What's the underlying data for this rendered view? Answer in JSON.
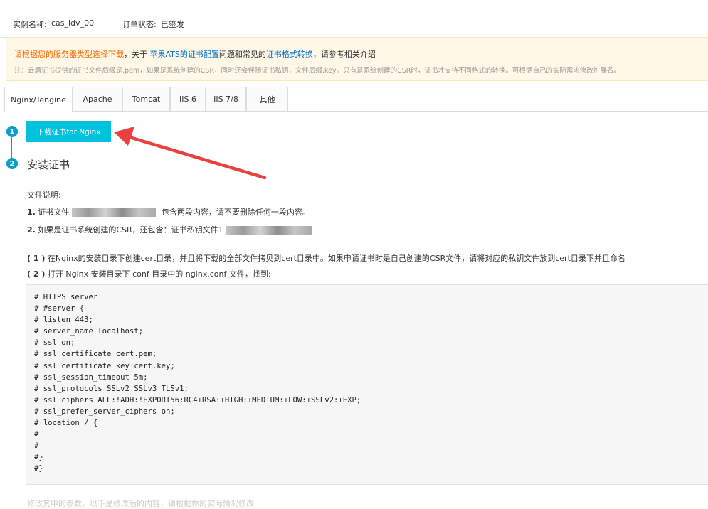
{
  "header": {
    "instance_label": "实例名称:",
    "instance_value": "cas_idv_00",
    "order_label": "订单状态:",
    "order_value": "已签发"
  },
  "notice": {
    "line1_warn": "请根据您的服务器类型选择下载",
    "line1_mid": "，关于",
    "line1_link1": "苹果ATS的证书配置",
    "line1_mid2": "问题和常见的",
    "line1_link2": "证书格式转换",
    "line1_end": "，请参考相关介绍",
    "line2": "注：云盾证书提供的证书文件后缀是.pem，如果是系统创建的CSR，同时还会伴随证书私钥，文件后缀.key。只有是系统创建的CSR时，证书才支持不同格式的转换。可根据自己的实际需求修改扩展名。"
  },
  "tabs": [
    "Nginx/Tengine",
    "Apache",
    "Tomcat",
    "IIS 6",
    "IIS 7/8",
    "其他"
  ],
  "steps": {
    "step1_number": "1",
    "download_button": "下载证书for Nginx",
    "step2_number": "2",
    "install_title": "安装证书"
  },
  "content": {
    "file_desc": "文件说明:",
    "item1_num": "1.",
    "item1_pre": "证书文件",
    "item1_post": "包含两段内容，请不要删除任何一段内容。",
    "item2_num": "2.",
    "item2_text": "如果是证书系统创建的CSR，还包含：证书私钥文件1",
    "p1_num": "( 1 )",
    "p1_text": "在Nginx的安装目录下创建cert目录，并且将下载的全部文件拷贝到cert目录中。如果申请证书时是自己创建的CSR文件，请将对应的私钥文件放到cert目录下并且命名",
    "p2_num": "( 2 )",
    "p2_text": "打开 Nginx 安装目录下 conf 目录中的 nginx.conf 文件，找到:",
    "bottom_text": "修改其中的参数，以下是修改后的内容，请根据你的实际情况修改"
  },
  "code": "# HTTPS server\n# #server {\n# listen 443;\n# server_name localhost;\n# ssl on;\n# ssl_certificate cert.pem;\n# ssl_certificate_key cert.key;\n# ssl_session_timeout 5m;\n# ssl_protocols SSLv2 SSLv3 TLSv1;\n# ssl_ciphers ALL:!ADH:!EXPORT56:RC4+RSA:+HIGH:+MEDIUM:+LOW:+SSLv2:+EXP;\n# ssl_prefer_server_ciphers on;\n# location / {\n#\n#\n#}\n#}",
  "colors": {
    "accent": "#00c1de",
    "step": "#00a2ca",
    "warning": "#ff6a00",
    "link": "#0070cc",
    "annotation_arrow": "#e8413f"
  }
}
